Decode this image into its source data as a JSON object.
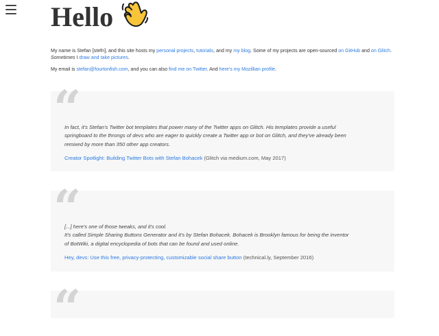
{
  "menu": {
    "icon": "hamburger-menu-icon"
  },
  "header": {
    "title": "Hello",
    "emoji_icon": "waving-hand-icon"
  },
  "intro": {
    "p1_prefix": "My name is Stefan [stefn], and this site hosts my ",
    "link_projects": "personal projects",
    "sep1": ", ",
    "link_tutorials": "tutorials",
    "sep2": ", and my ",
    "link_blog": "my blog",
    "p1_mid": ". Some of my projects are open-sourced ",
    "link_github": "on GitHub",
    "and": " and ",
    "link_glitch": "on Glitch",
    "p1_after_glitch": ". ",
    "sometimes": "Sometimes",
    "i_text": " I ",
    "link_draw": "draw and take pictures",
    "period": ".",
    "p2_prefix": "My email is ",
    "link_email": "stefan@fourtonfish.com",
    "p2_mid": ", and you can also ",
    "link_twitter": "find me on Twitter",
    "p2_mid2": ". And ",
    "link_mozillian": "here's my Mozillian profile",
    "p2_end": "."
  },
  "quotes": [
    {
      "text_lines": [
        "In fact, it's Stefan's Twitter bot templates that power many of the Twitter apps on Glitch. His templates provide a useful",
        "springboard to the throngs of devs who are eager to quickly create a Twitter app or bot on Glitch, and they've already been",
        "remixed by more than 350 other app creators."
      ],
      "cite_link": "Creator Spotlight: Building Twitter Bots with Stefan Bohacek",
      "cite_source": " (Glitch via medium.com, May 2017)"
    },
    {
      "text_lines": [
        "[...] here's one of those tweaks, and it's cool.",
        "It's called Simple Sharing Buttons Generator and it's by Stefan Bohacek. Bohacek is Brooklyn famous for being the inventor",
        "of BotWiki, a digital encyclopedia of bots that can be found and used online."
      ],
      "cite_link": "Hey, devs: Use this free, privacy-protecting, customizable social share button",
      "cite_source": " (technical.ly, September 2016)"
    }
  ],
  "quote_mark": "“",
  "colors": {
    "link": "#2a7ae2",
    "card_bg": "#f7f7f7",
    "quote_mark": "#d4d4d4"
  }
}
